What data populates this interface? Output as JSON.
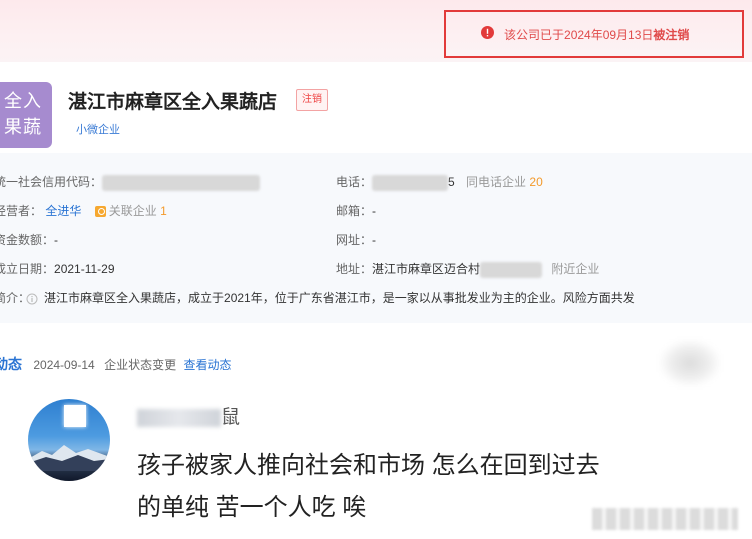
{
  "notice": {
    "text_prefix": "该公司已于",
    "date": "2024年09月13日",
    "text_suffix": "被注销"
  },
  "company": {
    "logo_line1": "全入",
    "logo_line2": "果蔬",
    "name": "湛江市麻章区全入果蔬店",
    "status_tag": "注销",
    "scale_tag": "小微企业"
  },
  "info": {
    "credit_code_label": "统一社会信用代码：",
    "operator_label": "经营者：",
    "operator_value": "全进华",
    "related_label": "关联企业",
    "related_count": "1",
    "capital_label": "资金数额：",
    "capital_value": "-",
    "founded_label": "成立日期：",
    "founded_value": "2021-11-29",
    "intro_label": "简介：",
    "intro_value": "湛江市麻章区全入果蔬店，成立于2021年，位于广东省湛江市，是一家以从事批发业为主的企业。风险方面共发",
    "phone_label": "电话：",
    "phone_tail": "5",
    "same_phone_label": "同电话企业",
    "same_phone_count": "20",
    "email_label": "邮箱：",
    "email_value": "-",
    "website_label": "网址：",
    "website_value": "-",
    "address_label": "地址：",
    "address_value": "湛江市麻章区迈合村",
    "nearby_label": "附近企业"
  },
  "dynamic": {
    "label": "动态",
    "date": "2024-09-14",
    "event": "企业状态变更",
    "link": "查看动态"
  },
  "comment": {
    "username_suffix": "鼠",
    "text_line1": "孩子被家人推向社会和市场 怎么在回到过去",
    "text_line2": "的单纯 苦一个人吃 唉"
  }
}
